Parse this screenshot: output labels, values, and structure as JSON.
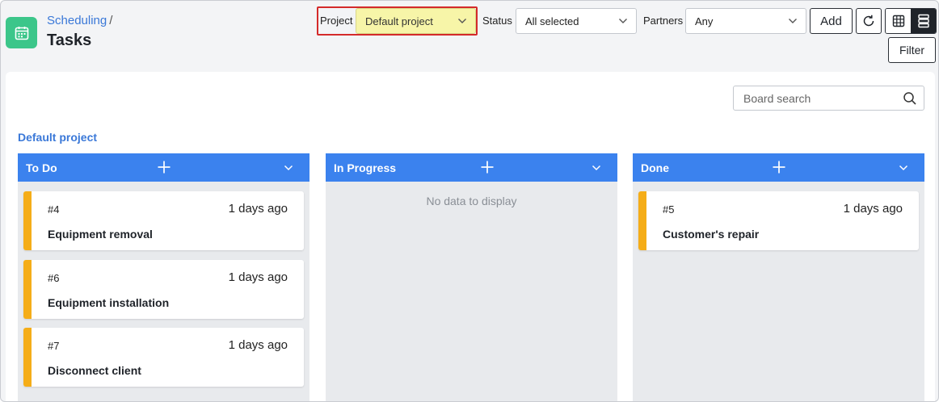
{
  "header": {
    "breadcrumb": "Scheduling",
    "breadcrumb_separator": "/",
    "title": "Tasks"
  },
  "filters": {
    "project_label": "Project",
    "project_value": "Default project",
    "status_label": "Status",
    "status_value": "All selected",
    "partners_label": "Partners",
    "partners_value": "Any",
    "add_label": "Add",
    "filter_label": "Filter"
  },
  "board": {
    "search_placeholder": "Board search",
    "project_heading": "Default project",
    "columns": [
      {
        "title": "To Do",
        "cards": [
          {
            "id": "#4",
            "time": "1 days ago",
            "title": "Equipment removal"
          },
          {
            "id": "#6",
            "time": "1 days ago",
            "title": "Equipment installation"
          },
          {
            "id": "#7",
            "time": "1 days ago",
            "title": "Disconnect client"
          }
        ]
      },
      {
        "title": "In Progress",
        "empty_message": "No data to display",
        "cards": []
      },
      {
        "title": "Done",
        "cards": [
          {
            "id": "#5",
            "time": "1 days ago",
            "title": "Customer's repair"
          }
        ]
      }
    ]
  },
  "colors": {
    "accent": "#3b82ee",
    "app_icon": "#3cc68a",
    "card_stripe": "#f5ad18",
    "project_highlight": "#f7f5a8",
    "annotation_border": "#d42a2a"
  },
  "icons": {
    "app": "calendar-icon",
    "refresh": "refresh-icon",
    "grid_view": "grid-icon",
    "list_view": "list-icon",
    "search": "search-icon",
    "add": "plus-icon",
    "dropdown": "chevron-down-icon"
  }
}
